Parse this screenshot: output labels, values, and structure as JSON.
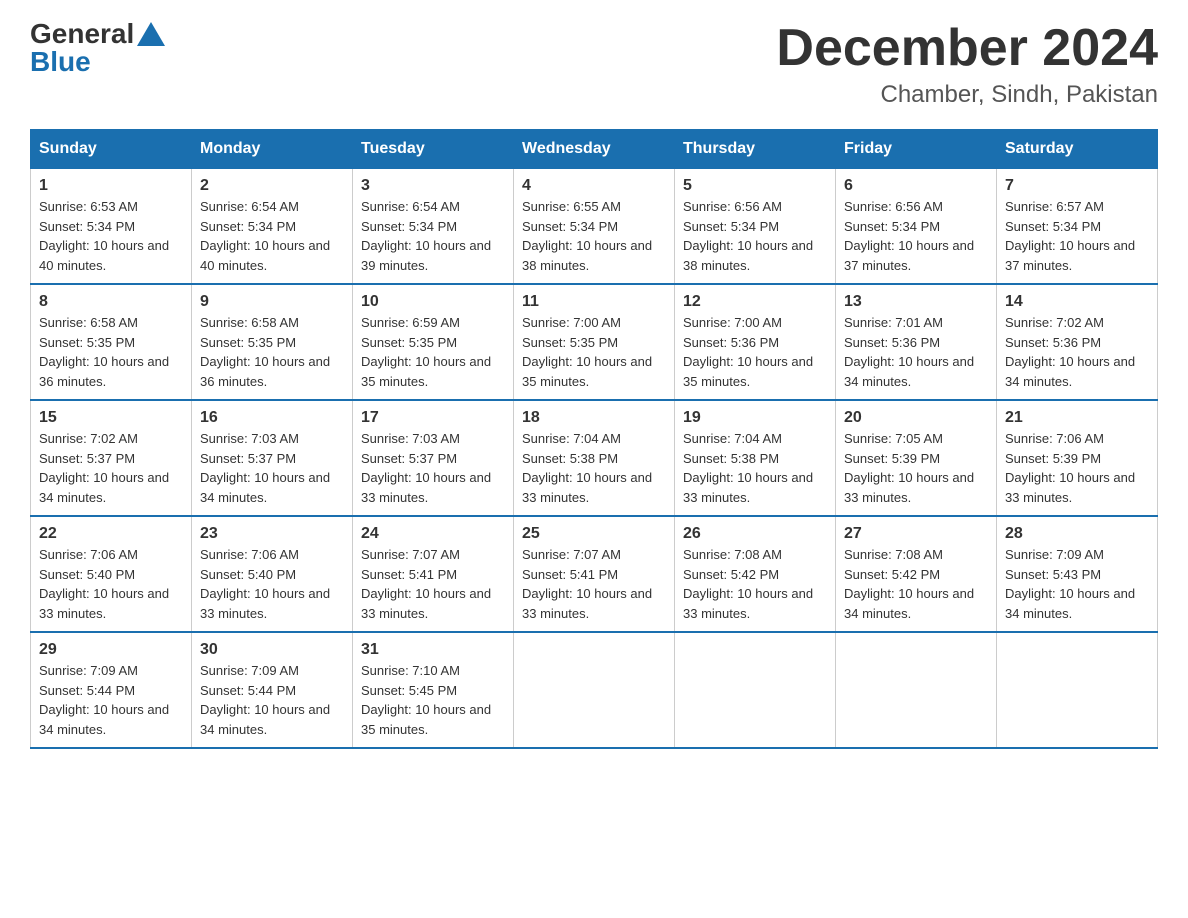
{
  "header": {
    "logo_general": "General",
    "logo_blue": "Blue",
    "month_title": "December 2024",
    "location": "Chamber, Sindh, Pakistan"
  },
  "weekdays": [
    "Sunday",
    "Monday",
    "Tuesday",
    "Wednesday",
    "Thursday",
    "Friday",
    "Saturday"
  ],
  "weeks": [
    [
      {
        "day": "1",
        "sunrise": "Sunrise: 6:53 AM",
        "sunset": "Sunset: 5:34 PM",
        "daylight": "Daylight: 10 hours and 40 minutes."
      },
      {
        "day": "2",
        "sunrise": "Sunrise: 6:54 AM",
        "sunset": "Sunset: 5:34 PM",
        "daylight": "Daylight: 10 hours and 40 minutes."
      },
      {
        "day": "3",
        "sunrise": "Sunrise: 6:54 AM",
        "sunset": "Sunset: 5:34 PM",
        "daylight": "Daylight: 10 hours and 39 minutes."
      },
      {
        "day": "4",
        "sunrise": "Sunrise: 6:55 AM",
        "sunset": "Sunset: 5:34 PM",
        "daylight": "Daylight: 10 hours and 38 minutes."
      },
      {
        "day": "5",
        "sunrise": "Sunrise: 6:56 AM",
        "sunset": "Sunset: 5:34 PM",
        "daylight": "Daylight: 10 hours and 38 minutes."
      },
      {
        "day": "6",
        "sunrise": "Sunrise: 6:56 AM",
        "sunset": "Sunset: 5:34 PM",
        "daylight": "Daylight: 10 hours and 37 minutes."
      },
      {
        "day": "7",
        "sunrise": "Sunrise: 6:57 AM",
        "sunset": "Sunset: 5:34 PM",
        "daylight": "Daylight: 10 hours and 37 minutes."
      }
    ],
    [
      {
        "day": "8",
        "sunrise": "Sunrise: 6:58 AM",
        "sunset": "Sunset: 5:35 PM",
        "daylight": "Daylight: 10 hours and 36 minutes."
      },
      {
        "day": "9",
        "sunrise": "Sunrise: 6:58 AM",
        "sunset": "Sunset: 5:35 PM",
        "daylight": "Daylight: 10 hours and 36 minutes."
      },
      {
        "day": "10",
        "sunrise": "Sunrise: 6:59 AM",
        "sunset": "Sunset: 5:35 PM",
        "daylight": "Daylight: 10 hours and 35 minutes."
      },
      {
        "day": "11",
        "sunrise": "Sunrise: 7:00 AM",
        "sunset": "Sunset: 5:35 PM",
        "daylight": "Daylight: 10 hours and 35 minutes."
      },
      {
        "day": "12",
        "sunrise": "Sunrise: 7:00 AM",
        "sunset": "Sunset: 5:36 PM",
        "daylight": "Daylight: 10 hours and 35 minutes."
      },
      {
        "day": "13",
        "sunrise": "Sunrise: 7:01 AM",
        "sunset": "Sunset: 5:36 PM",
        "daylight": "Daylight: 10 hours and 34 minutes."
      },
      {
        "day": "14",
        "sunrise": "Sunrise: 7:02 AM",
        "sunset": "Sunset: 5:36 PM",
        "daylight": "Daylight: 10 hours and 34 minutes."
      }
    ],
    [
      {
        "day": "15",
        "sunrise": "Sunrise: 7:02 AM",
        "sunset": "Sunset: 5:37 PM",
        "daylight": "Daylight: 10 hours and 34 minutes."
      },
      {
        "day": "16",
        "sunrise": "Sunrise: 7:03 AM",
        "sunset": "Sunset: 5:37 PM",
        "daylight": "Daylight: 10 hours and 34 minutes."
      },
      {
        "day": "17",
        "sunrise": "Sunrise: 7:03 AM",
        "sunset": "Sunset: 5:37 PM",
        "daylight": "Daylight: 10 hours and 33 minutes."
      },
      {
        "day": "18",
        "sunrise": "Sunrise: 7:04 AM",
        "sunset": "Sunset: 5:38 PM",
        "daylight": "Daylight: 10 hours and 33 minutes."
      },
      {
        "day": "19",
        "sunrise": "Sunrise: 7:04 AM",
        "sunset": "Sunset: 5:38 PM",
        "daylight": "Daylight: 10 hours and 33 minutes."
      },
      {
        "day": "20",
        "sunrise": "Sunrise: 7:05 AM",
        "sunset": "Sunset: 5:39 PM",
        "daylight": "Daylight: 10 hours and 33 minutes."
      },
      {
        "day": "21",
        "sunrise": "Sunrise: 7:06 AM",
        "sunset": "Sunset: 5:39 PM",
        "daylight": "Daylight: 10 hours and 33 minutes."
      }
    ],
    [
      {
        "day": "22",
        "sunrise": "Sunrise: 7:06 AM",
        "sunset": "Sunset: 5:40 PM",
        "daylight": "Daylight: 10 hours and 33 minutes."
      },
      {
        "day": "23",
        "sunrise": "Sunrise: 7:06 AM",
        "sunset": "Sunset: 5:40 PM",
        "daylight": "Daylight: 10 hours and 33 minutes."
      },
      {
        "day": "24",
        "sunrise": "Sunrise: 7:07 AM",
        "sunset": "Sunset: 5:41 PM",
        "daylight": "Daylight: 10 hours and 33 minutes."
      },
      {
        "day": "25",
        "sunrise": "Sunrise: 7:07 AM",
        "sunset": "Sunset: 5:41 PM",
        "daylight": "Daylight: 10 hours and 33 minutes."
      },
      {
        "day": "26",
        "sunrise": "Sunrise: 7:08 AM",
        "sunset": "Sunset: 5:42 PM",
        "daylight": "Daylight: 10 hours and 33 minutes."
      },
      {
        "day": "27",
        "sunrise": "Sunrise: 7:08 AM",
        "sunset": "Sunset: 5:42 PM",
        "daylight": "Daylight: 10 hours and 34 minutes."
      },
      {
        "day": "28",
        "sunrise": "Sunrise: 7:09 AM",
        "sunset": "Sunset: 5:43 PM",
        "daylight": "Daylight: 10 hours and 34 minutes."
      }
    ],
    [
      {
        "day": "29",
        "sunrise": "Sunrise: 7:09 AM",
        "sunset": "Sunset: 5:44 PM",
        "daylight": "Daylight: 10 hours and 34 minutes."
      },
      {
        "day": "30",
        "sunrise": "Sunrise: 7:09 AM",
        "sunset": "Sunset: 5:44 PM",
        "daylight": "Daylight: 10 hours and 34 minutes."
      },
      {
        "day": "31",
        "sunrise": "Sunrise: 7:10 AM",
        "sunset": "Sunset: 5:45 PM",
        "daylight": "Daylight: 10 hours and 35 minutes."
      },
      null,
      null,
      null,
      null
    ]
  ]
}
